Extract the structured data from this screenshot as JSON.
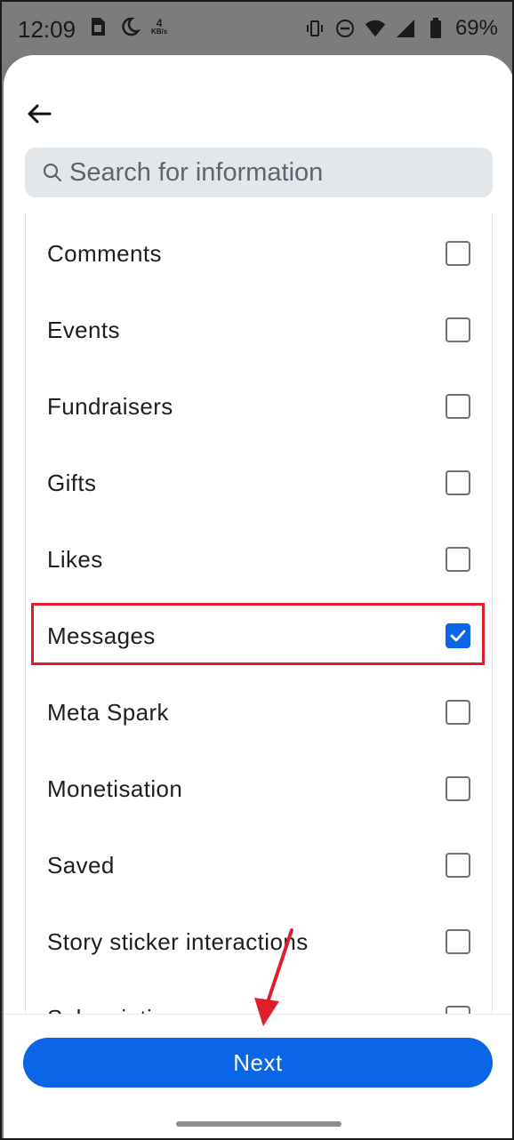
{
  "status_bar": {
    "time": "12:09",
    "net_speed_value": "4",
    "net_speed_unit": "KB/s",
    "battery": "69%",
    "icons": [
      "sim-icon",
      "night-mode-icon",
      "vibrate-icon",
      "dnd-icon",
      "wifi-icon",
      "signal-icon",
      "battery-icon"
    ]
  },
  "search": {
    "placeholder": "Search for information"
  },
  "list": {
    "items": [
      {
        "label": "Comments",
        "checked": false
      },
      {
        "label": "Events",
        "checked": false
      },
      {
        "label": "Fundraisers",
        "checked": false
      },
      {
        "label": "Gifts",
        "checked": false
      },
      {
        "label": "Likes",
        "checked": false
      },
      {
        "label": "Messages",
        "checked": true
      },
      {
        "label": "Meta Spark",
        "checked": false
      },
      {
        "label": "Monetisation",
        "checked": false
      },
      {
        "label": "Saved",
        "checked": false
      },
      {
        "label": "Story sticker interactions",
        "checked": false
      },
      {
        "label": "Subscriptions",
        "checked": false
      }
    ]
  },
  "footer": {
    "next_label": "Next"
  },
  "colors": {
    "accent": "#0a66e6",
    "highlight": "#e01e2b"
  }
}
